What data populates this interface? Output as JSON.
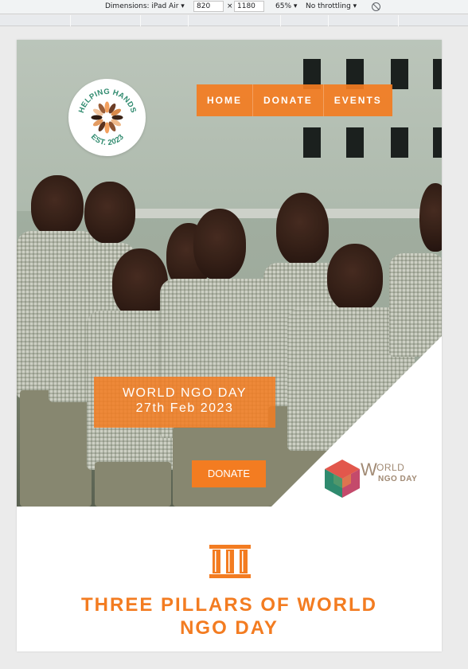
{
  "devtools": {
    "dimensions_label": "Dimensions: iPad Air ▾",
    "width": "820",
    "separator": "×",
    "height": "1180",
    "zoom": "65% ▾",
    "throttling": "No throttling ▾"
  },
  "logo": {
    "top_text": "HELPING HANDS",
    "bottom_text": "EST. 2023"
  },
  "nav": {
    "items": [
      "HOME",
      "DONATE",
      "EVENTS"
    ]
  },
  "event": {
    "title": "WORLD NGO DAY",
    "date": "27th Feb 2023"
  },
  "hero": {
    "donate_label": "DONATE"
  },
  "world_ngo_logo": {
    "letter": "W",
    "orld": "ORLD",
    "sub": "NGO DAY"
  },
  "pillars": {
    "icon": "pillars-icon",
    "title_line1": "THREE PILLARS OF WORLD",
    "title_line2": "NGO DAY"
  },
  "colors": {
    "accent": "#f37c21",
    "page_bg": "#ffffff",
    "chrome_bg": "#ebebeb"
  }
}
